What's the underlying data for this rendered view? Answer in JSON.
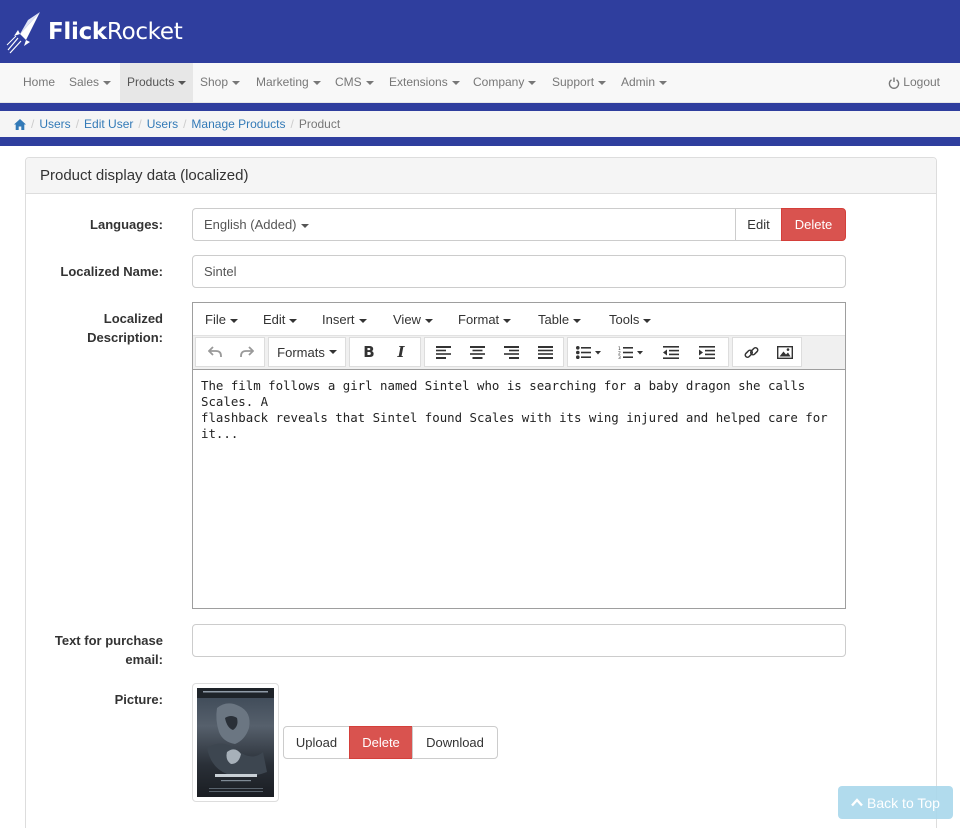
{
  "header": {
    "logo_bold": "Flick",
    "logo_light": "Rocket"
  },
  "nav": {
    "items": [
      {
        "label": "Home",
        "dropdown": false
      },
      {
        "label": "Sales",
        "dropdown": true
      },
      {
        "label": "Products",
        "dropdown": true,
        "active": true
      },
      {
        "label": "Shop",
        "dropdown": true
      },
      {
        "label": "Marketing",
        "dropdown": true
      },
      {
        "label": "CMS",
        "dropdown": true
      },
      {
        "label": "Extensions",
        "dropdown": true
      },
      {
        "label": "Company",
        "dropdown": true
      },
      {
        "label": "Support",
        "dropdown": true
      },
      {
        "label": "Admin",
        "dropdown": true
      }
    ],
    "logout_label": "Logout"
  },
  "breadcrumb": [
    "Users",
    "Edit User",
    "Users",
    "Manage Products",
    "Product"
  ],
  "panel": {
    "heading": "Product display data (localized)"
  },
  "form": {
    "languages_label": "Languages:",
    "language_value": "English (Added)",
    "edit_label": "Edit",
    "delete_label": "Delete",
    "localized_name_label": "Localized Name:",
    "localized_name_value": "Sintel",
    "description_label_1": "Localized",
    "description_label_2": "Description:",
    "purchase_email_label_1": "Text for purchase",
    "purchase_email_label_2": "email:",
    "purchase_email_value": "",
    "picture_label": "Picture:",
    "upload_label": "Upload",
    "picture_delete_label": "Delete",
    "download_label": "Download"
  },
  "editor": {
    "menus": [
      "File",
      "Edit",
      "Insert",
      "View",
      "Format",
      "Table",
      "Tools"
    ],
    "formats_label": "Formats",
    "content_line_1": "The film follows a girl named Sintel who is searching for a baby dragon she calls Scales. A",
    "content_line_2": "flashback reveals that Sintel found Scales with its wing injured and helped care for it..."
  },
  "back_to_top": "Back to Top",
  "colors": {
    "brand_blue": "#2f3e9e",
    "danger": "#d9534f",
    "link": "#337ab7"
  }
}
